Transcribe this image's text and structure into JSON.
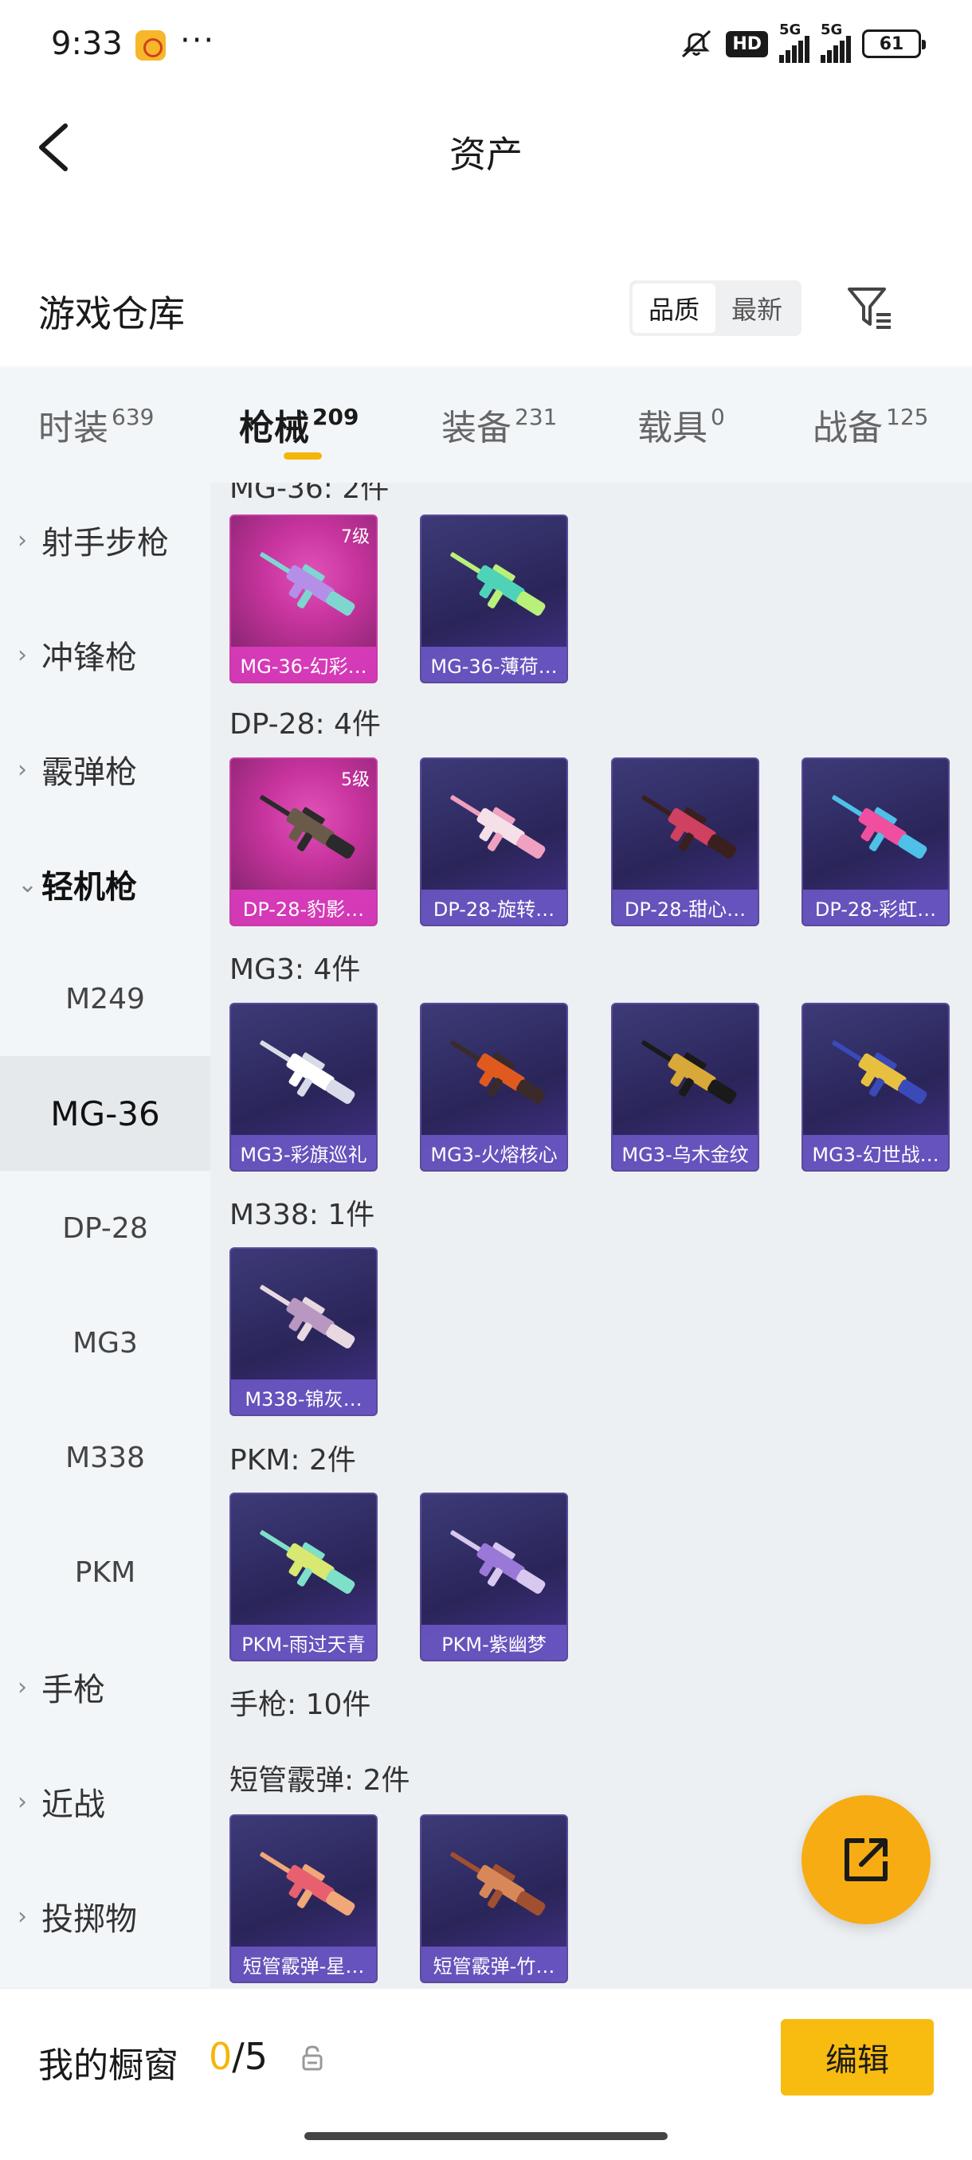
{
  "status_bar": {
    "time": "9:33",
    "dots": "···",
    "hd": "HD",
    "sim1": "5G",
    "sim2": "5G",
    "battery": "61"
  },
  "header": {
    "title": "资产"
  },
  "section": {
    "title": "游戏仓库",
    "sort_options": [
      "品质",
      "最新"
    ],
    "sort_active": "品质"
  },
  "tabs": [
    {
      "label": "时装",
      "count": "639"
    },
    {
      "label": "枪械",
      "count": "209"
    },
    {
      "label": "装备",
      "count": "231"
    },
    {
      "label": "载具",
      "count": "0"
    },
    {
      "label": "战备",
      "count": "125"
    }
  ],
  "active_tab": "枪械",
  "side_nav": [
    {
      "label": "射手步枪",
      "type": "category"
    },
    {
      "label": "冲锋枪",
      "type": "category"
    },
    {
      "label": "霰弹枪",
      "type": "category"
    },
    {
      "label": "轻机枪",
      "type": "category-open"
    },
    {
      "label": "M249",
      "type": "sub"
    },
    {
      "label": "MG-36",
      "type": "sub-selected"
    },
    {
      "label": "DP-28",
      "type": "sub"
    },
    {
      "label": "MG3",
      "type": "sub"
    },
    {
      "label": "M338",
      "type": "sub"
    },
    {
      "label": "PKM",
      "type": "sub"
    },
    {
      "label": "手枪",
      "type": "category"
    },
    {
      "label": "近战",
      "type": "category"
    },
    {
      "label": "投掷物",
      "type": "category"
    }
  ],
  "groups": [
    {
      "title": "MG-36: 2件",
      "items": [
        {
          "name": "MG-36-幻彩…",
          "level": "7级",
          "rarity": "legend",
          "colors": [
            "#7fd6d0",
            "#b58ee8"
          ]
        },
        {
          "name": "MG-36-薄荷…",
          "level": "",
          "rarity": "epic",
          "colors": [
            "#b9f07a",
            "#4fd3b8"
          ]
        }
      ]
    },
    {
      "title": "DP-28: 4件",
      "items": [
        {
          "name": "DP-28-豹影…",
          "level": "5级",
          "rarity": "legend",
          "colors": [
            "#2a2a2a",
            "#6a5a4a"
          ]
        },
        {
          "name": "DP-28-旋转…",
          "level": "",
          "rarity": "epic",
          "colors": [
            "#f0a0c0",
            "#f5e0e8"
          ]
        },
        {
          "name": "DP-28-甜心…",
          "level": "",
          "rarity": "epic",
          "colors": [
            "#3a1f1f",
            "#d04060"
          ]
        },
        {
          "name": "DP-28-彩虹…",
          "level": "",
          "rarity": "epic",
          "colors": [
            "#4fc0e8",
            "#f04f9f"
          ]
        }
      ]
    },
    {
      "title": "MG3: 4件",
      "items": [
        {
          "name": "MG3-彩旗巡礼",
          "level": "",
          "rarity": "epic",
          "colors": [
            "#d8dce8",
            "#ffffff"
          ]
        },
        {
          "name": "MG3-火熔核心",
          "level": "",
          "rarity": "epic",
          "colors": [
            "#3a2a2a",
            "#e05a20"
          ]
        },
        {
          "name": "MG3-乌木金纹",
          "level": "",
          "rarity": "epic",
          "colors": [
            "#1a1a1a",
            "#d8a838"
          ]
        },
        {
          "name": "MG3-幻世战…",
          "level": "",
          "rarity": "epic",
          "colors": [
            "#3a4ab8",
            "#e8c040"
          ]
        }
      ]
    },
    {
      "title": "M338: 1件",
      "items": [
        {
          "name": "M338-锦灰…",
          "level": "",
          "rarity": "epic",
          "colors": [
            "#e8d8e0",
            "#b898c0"
          ]
        }
      ]
    },
    {
      "title": "PKM: 2件",
      "items": [
        {
          "name": "PKM-雨过天青",
          "level": "",
          "rarity": "epic",
          "colors": [
            "#7ee0c8",
            "#d8e870"
          ]
        },
        {
          "name": "PKM-紫幽梦",
          "level": "",
          "rarity": "epic",
          "colors": [
            "#d8c8f0",
            "#9a78d8"
          ]
        }
      ]
    },
    {
      "title": "手枪: 10件",
      "items": []
    },
    {
      "title": "短管霰弹: 2件",
      "items": [
        {
          "name": "短管霰弹-星…",
          "level": "",
          "rarity": "epic",
          "colors": [
            "#f0a878",
            "#e86070"
          ]
        },
        {
          "name": "短管霰弹-竹…",
          "level": "",
          "rarity": "epic",
          "colors": [
            "#a05030",
            "#d88858"
          ]
        }
      ]
    }
  ],
  "bottom": {
    "showcase_label": "我的橱窗",
    "showcase_current": "0",
    "showcase_sep": "/",
    "showcase_max": "5",
    "edit_label": "编辑"
  },
  "colors": {
    "accent": "#f5b50a",
    "legend": "#d03aa8",
    "epic": "#5b4a9a"
  }
}
